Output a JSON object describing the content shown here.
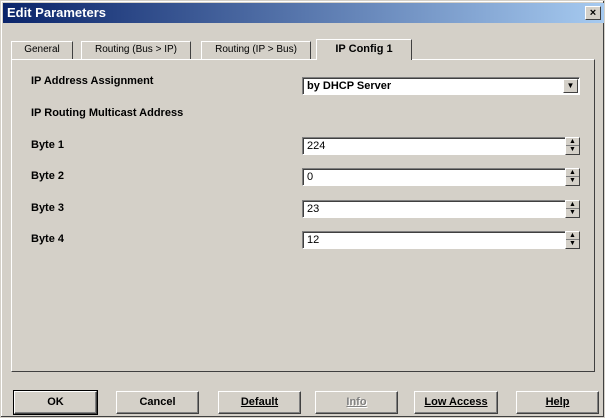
{
  "window": {
    "title": "Edit Parameters"
  },
  "titlebar": {
    "close_glyph": "×"
  },
  "tabs": [
    {
      "label": "General"
    },
    {
      "label": "Routing (Bus > IP)"
    },
    {
      "label": "Routing (IP > Bus)"
    },
    {
      "label": "IP Config 1"
    }
  ],
  "form": {
    "ip_assignment_label": "IP Address Assignment",
    "ip_assignment_value": "by DHCP Server",
    "multicast_heading": "IP Routing Multicast Address",
    "bytes": [
      {
        "label": "Byte 1",
        "value": "224"
      },
      {
        "label": "Byte 2",
        "value": "0"
      },
      {
        "label": "Byte 3",
        "value": "23"
      },
      {
        "label": "Byte 4",
        "value": "12"
      }
    ]
  },
  "buttons": {
    "ok": "OK",
    "cancel": "Cancel",
    "default": "Default",
    "info": "Info",
    "low_access": "Low Access",
    "help": "Help"
  },
  "colors": {
    "titlebar_start": "#0a246a",
    "titlebar_end": "#a6caf0",
    "face": "#d4d0c8"
  },
  "icons": {
    "close": "close-icon",
    "dropdown": "chevron-down-icon",
    "spin_up": "arrow-up-icon",
    "spin_down": "arrow-down-icon"
  }
}
